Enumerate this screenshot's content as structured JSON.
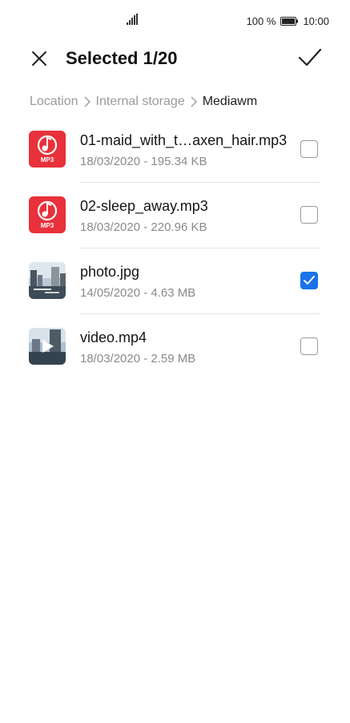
{
  "status_bar": {
    "battery_percent": "100 %",
    "time": "10:00"
  },
  "toolbar": {
    "title": "Selected 1/20",
    "close_icon": "close-icon",
    "confirm_icon": "checkmark-icon"
  },
  "breadcrumb": {
    "items": [
      "Location",
      "Internal storage",
      "Mediawm"
    ]
  },
  "files": [
    {
      "name": "01-maid_with_t…axen_hair.mp3",
      "meta": "18/03/2020 - 195.34 KB",
      "type_label": "MP3",
      "checked": false
    },
    {
      "name": "02-sleep_away.mp3",
      "meta": "18/03/2020 - 220.96 KB",
      "type_label": "MP3",
      "checked": false
    },
    {
      "name": "photo.jpg",
      "meta": "14/05/2020 - 4.63 MB",
      "checked": true
    },
    {
      "name": "video.mp4",
      "meta": "18/03/2020 - 2.59 MB",
      "checked": false
    }
  ],
  "colors": {
    "accent": "#1a73e8",
    "mp3_icon": "#e8313a"
  }
}
